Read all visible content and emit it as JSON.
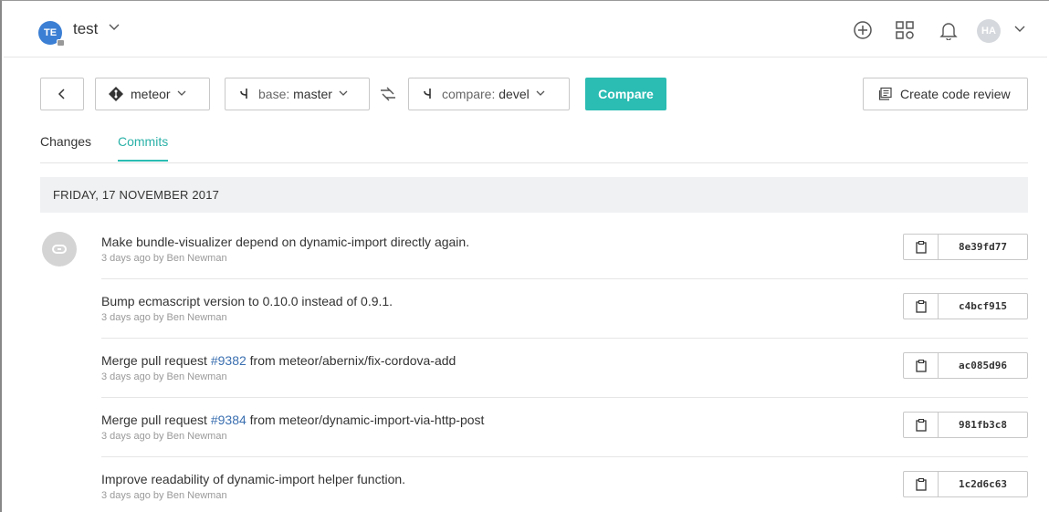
{
  "workspace": {
    "initials": "TE",
    "name": "test"
  },
  "user": {
    "initials": "HA"
  },
  "toolbar": {
    "repo": "meteor",
    "base_prefix": "base:",
    "base_branch": "master",
    "compare_prefix": "compare:",
    "compare_branch": "devel",
    "compare_label": "Compare",
    "review_label": "Create code review"
  },
  "tabs": [
    {
      "label": "Changes",
      "active": false
    },
    {
      "label": "Commits",
      "active": true
    }
  ],
  "date_header": "FRIDAY, 17 NOVEMBER 2017",
  "commits": [
    {
      "msg_pre": "Make bundle-visualizer depend on dynamic-import directly again.",
      "pr": "",
      "msg_post": "",
      "meta": "3 days ago by Ben Newman",
      "sha": "8e39fd77"
    },
    {
      "msg_pre": "Bump ecmascript version to 0.10.0 instead of 0.9.1.",
      "pr": "",
      "msg_post": "",
      "meta": "3 days ago by Ben Newman",
      "sha": "c4bcf915"
    },
    {
      "msg_pre": "Merge pull request ",
      "pr": "#9382",
      "msg_post": " from meteor/abernix/fix-cordova-add",
      "meta": "3 days ago by Ben Newman",
      "sha": "ac085d96"
    },
    {
      "msg_pre": "Merge pull request ",
      "pr": "#9384",
      "msg_post": " from meteor/dynamic-import-via-http-post",
      "meta": "3 days ago by Ben Newman",
      "sha": "981fb3c8"
    },
    {
      "msg_pre": "Improve readability of dynamic-import helper function.",
      "pr": "",
      "msg_post": "",
      "meta": "3 days ago by Ben Newman",
      "sha": "1c2d6c63"
    }
  ],
  "colors": {
    "accent": "#2bbcb3",
    "link": "#3a6fb0",
    "workspace_avatar": "#3b7fd4"
  },
  "icons": [
    "plus-circle-icon",
    "apps-grid-icon",
    "bell-icon",
    "chevron-down-icon",
    "git-repo-icon",
    "branch-icon",
    "swap-icon",
    "code-review-icon",
    "clipboard-icon",
    "chevron-left-icon"
  ]
}
